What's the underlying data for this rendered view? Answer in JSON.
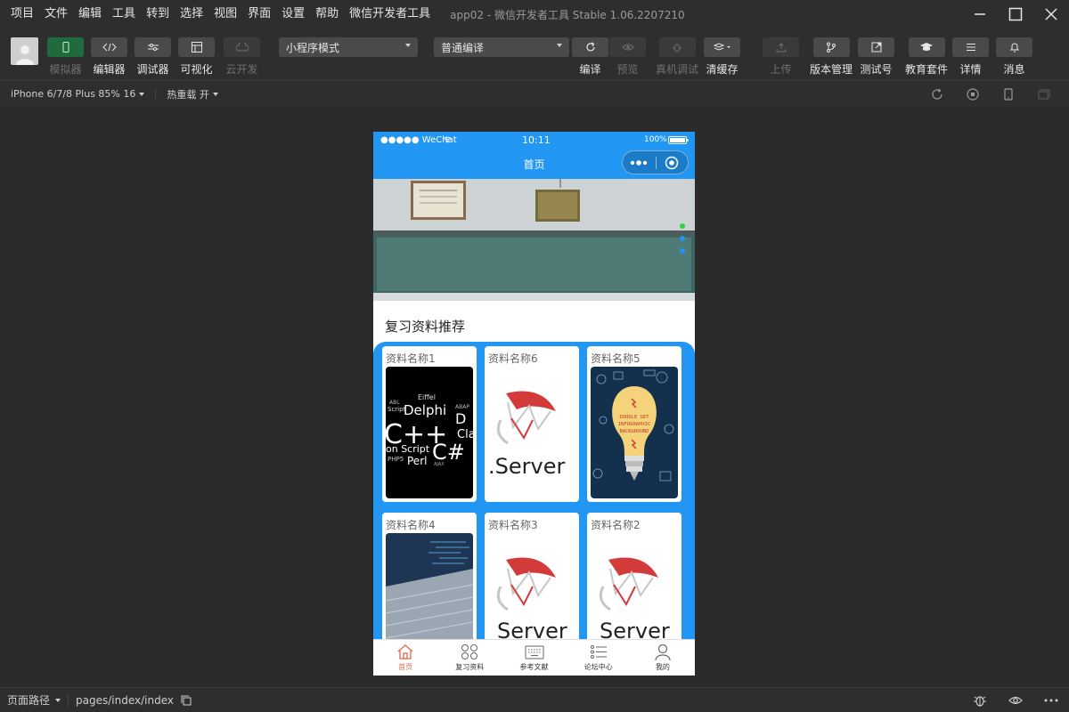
{
  "menubar": {
    "items": [
      "项目",
      "文件",
      "编辑",
      "工具",
      "转到",
      "选择",
      "视图",
      "界面",
      "设置",
      "帮助",
      "微信开发者工具"
    ],
    "window_title": "app02 - 微信开发者工具 Stable 1.06.2207210"
  },
  "toolbar": {
    "simulator": "模拟器",
    "editor": "编辑器",
    "debugger": "调试器",
    "visual": "可视化",
    "cloud": "云开发",
    "mode_select": "小程序模式",
    "compile_select": "普通编译",
    "compile": "编译",
    "preview": "预览",
    "remote_debug": "真机调试",
    "clear_cache": "清缓存",
    "upload": "上传",
    "version": "版本管理",
    "test_account": "测试号",
    "edu": "教育套件",
    "details": "详情",
    "messages": "消息"
  },
  "subbar": {
    "device": "iPhone 6/7/8 Plus 85% 16",
    "hot_reload": "热重载 开"
  },
  "phone": {
    "status": {
      "carrier": "●●●●● WeChat",
      "time": "10:11",
      "battery": "100%"
    },
    "nav_title": "首页",
    "section_title": "复习资料推荐",
    "cards": [
      {
        "title": "资料名称1"
      },
      {
        "title": "资料名称6"
      },
      {
        "title": "资料名称5"
      },
      {
        "title": "资料名称4"
      },
      {
        "title": "资料名称3"
      },
      {
        "title": "资料名称2"
      }
    ],
    "prog_words": {
      "w1": "Eiffel",
      "w2": "ABL",
      "w3": "Script",
      "w4": "Delphi",
      "w5": "ABAP",
      "w6": "C++",
      "w7": "C#",
      "w8": "on Script",
      "w9": "PHP5",
      "w10": "Perl",
      "w11": "AJAX",
      "w12": "D",
      "w13": "Cla"
    },
    "sql_text": ".Server",
    "sql_text_short": "Server",
    "bulb_text": {
      "line1": "DOODLE SET",
      "line2": "INFOGRAPHIC",
      "line3": "BACKGROUND"
    },
    "tabs": [
      {
        "label": "首页"
      },
      {
        "label": "复习资料"
      },
      {
        "label": "参考文献"
      },
      {
        "label": "论坛中心"
      },
      {
        "label": "我的"
      }
    ]
  },
  "bottombar": {
    "path_label": "页面路径",
    "path": "pages/index/index"
  },
  "colors": {
    "wechat_blue": "#2196f3",
    "active_tab": "#e06b4a",
    "simulator_active": "#1f6b3e"
  }
}
